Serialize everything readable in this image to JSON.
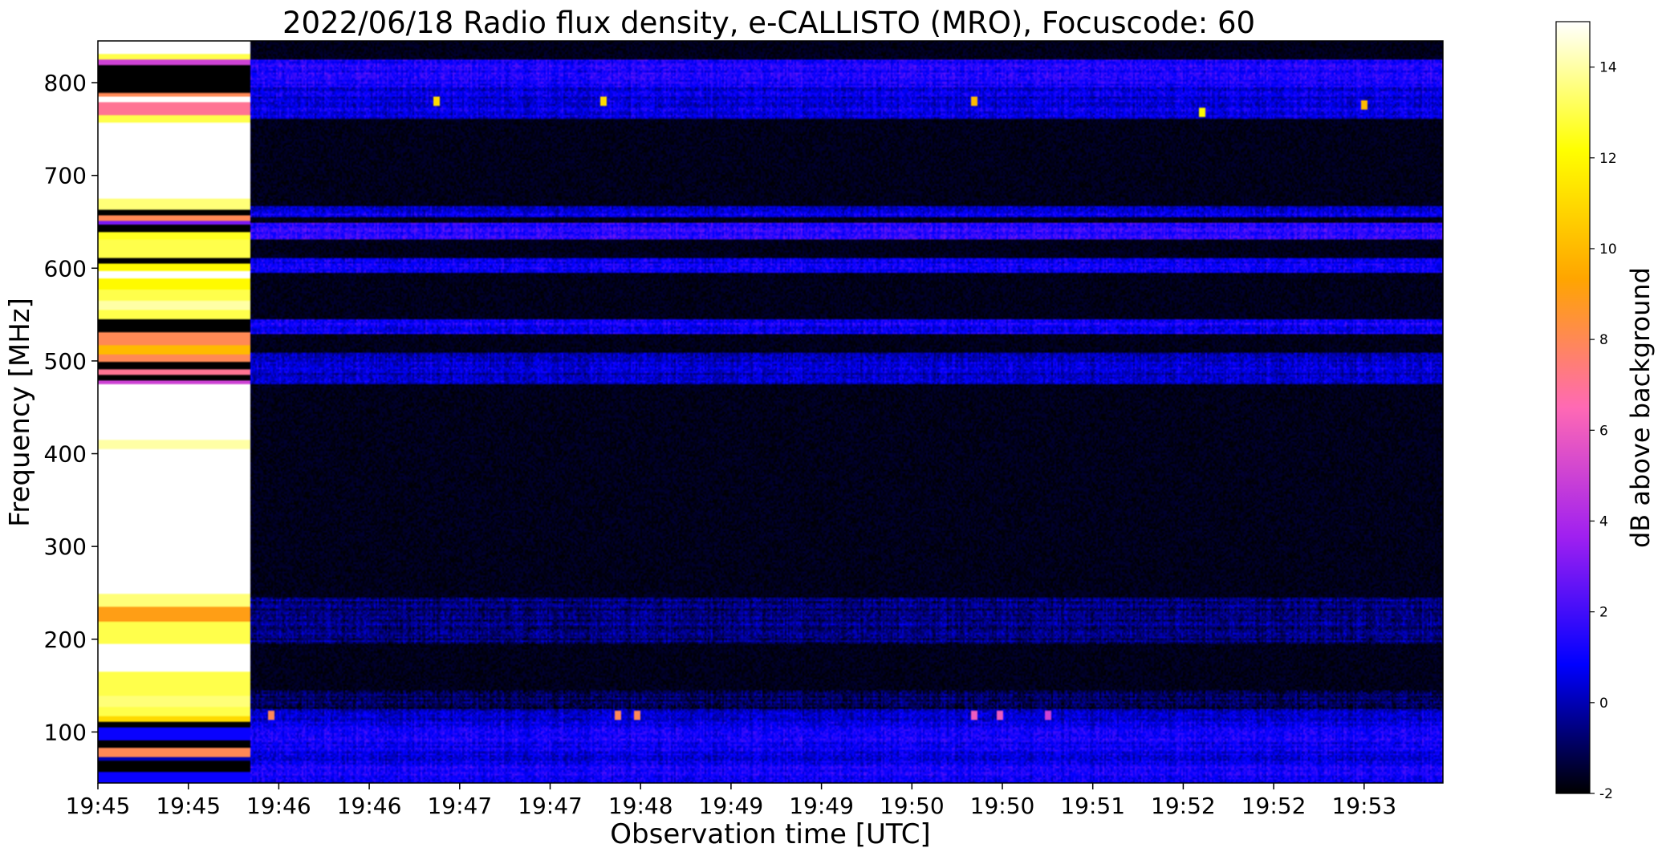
{
  "chart_data": {
    "type": "heatmap",
    "title": "2022/06/18  Radio flux density, e-CALLISTO (MRO), Focuscode: 60",
    "xlabel": "Observation time [UTC]",
    "ylabel": "Frequency [MHz]",
    "colorbar_label": "dB above background",
    "x_tick_labels": [
      "19:45",
      "19:45",
      "19:46",
      "19:46",
      "19:47",
      "19:47",
      "19:48",
      "19:49",
      "19:49",
      "19:50",
      "19:50",
      "19:51",
      "19:52",
      "19:52",
      "19:53"
    ],
    "y_ticks": [
      100,
      200,
      300,
      400,
      500,
      600,
      700,
      800
    ],
    "ylim": [
      45,
      845
    ],
    "colorbar_ticks": [
      -2,
      0,
      2,
      4,
      6,
      8,
      10,
      12,
      14
    ],
    "clim": [
      -2,
      15
    ],
    "colormap": [
      "#000000",
      "#0000ff",
      "#a020f0",
      "#ff69b4",
      "#ffa500",
      "#ffff00",
      "#ffffff"
    ],
    "calibration_segment": {
      "time_fraction_end": 0.113,
      "bands": [
        {
          "freq_min": 45,
          "freq_max": 58,
          "db": 1.0
        },
        {
          "freq_min": 58,
          "freq_max": 70,
          "db": -2.0
        },
        {
          "freq_min": 70,
          "freq_max": 74,
          "db": 0.0
        },
        {
          "freq_min": 74,
          "freq_max": 83,
          "db": 8.0
        },
        {
          "freq_min": 83,
          "freq_max": 92,
          "db": -2.0
        },
        {
          "freq_min": 92,
          "freq_max": 106,
          "db": 1.0
        },
        {
          "freq_min": 106,
          "freq_max": 112,
          "db": -2.0
        },
        {
          "freq_min": 112,
          "freq_max": 118,
          "db": 11.0
        },
        {
          "freq_min": 118,
          "freq_max": 128,
          "db": 13.0
        },
        {
          "freq_min": 128,
          "freq_max": 140,
          "db": 13.5
        },
        {
          "freq_min": 140,
          "freq_max": 165,
          "db": 13.0
        },
        {
          "freq_min": 165,
          "freq_max": 195,
          "db": 15.0
        },
        {
          "freq_min": 195,
          "freq_max": 220,
          "db": 13.0
        },
        {
          "freq_min": 220,
          "freq_max": 235,
          "db": 9.0
        },
        {
          "freq_min": 235,
          "freq_max": 250,
          "db": 13.5
        },
        {
          "freq_min": 250,
          "freq_max": 405,
          "db": 15.0
        },
        {
          "freq_min": 405,
          "freq_max": 415,
          "db": 14.0
        },
        {
          "freq_min": 415,
          "freq_max": 475,
          "db": 15.0
        },
        {
          "freq_min": 475,
          "freq_max": 480,
          "db": 5.0
        },
        {
          "freq_min": 480,
          "freq_max": 485,
          "db": -2.0
        },
        {
          "freq_min": 485,
          "freq_max": 492,
          "db": 7.0
        },
        {
          "freq_min": 492,
          "freq_max": 500,
          "db": -2.0
        },
        {
          "freq_min": 500,
          "freq_max": 508,
          "db": 8.0
        },
        {
          "freq_min": 508,
          "freq_max": 518,
          "db": 10.0
        },
        {
          "freq_min": 518,
          "freq_max": 532,
          "db": 8.0
        },
        {
          "freq_min": 532,
          "freq_max": 545,
          "db": -2.0
        },
        {
          "freq_min": 545,
          "freq_max": 555,
          "db": 13.0
        },
        {
          "freq_min": 555,
          "freq_max": 565,
          "db": 14.0
        },
        {
          "freq_min": 565,
          "freq_max": 578,
          "db": 13.0
        },
        {
          "freq_min": 578,
          "freq_max": 590,
          "db": 12.0
        },
        {
          "freq_min": 590,
          "freq_max": 598,
          "db": 15.0
        },
        {
          "freq_min": 598,
          "freq_max": 605,
          "db": 12.0
        },
        {
          "freq_min": 605,
          "freq_max": 612,
          "db": -2.0
        },
        {
          "freq_min": 612,
          "freq_max": 632,
          "db": 13.0
        },
        {
          "freq_min": 632,
          "freq_max": 640,
          "db": 12.5
        },
        {
          "freq_min": 640,
          "freq_max": 648,
          "db": -2.0
        },
        {
          "freq_min": 648,
          "freq_max": 652,
          "db": 3.0
        },
        {
          "freq_min": 652,
          "freq_max": 658,
          "db": 8.0
        },
        {
          "freq_min": 658,
          "freq_max": 664,
          "db": -2.0
        },
        {
          "freq_min": 664,
          "freq_max": 675,
          "db": 13.5
        },
        {
          "freq_min": 675,
          "freq_max": 758,
          "db": 15.0
        },
        {
          "freq_min": 758,
          "freq_max": 765,
          "db": 13.0
        },
        {
          "freq_min": 765,
          "freq_max": 780,
          "db": 7.0
        },
        {
          "freq_min": 780,
          "freq_max": 785,
          "db": 15.0
        },
        {
          "freq_min": 785,
          "freq_max": 790,
          "db": 8.0
        },
        {
          "freq_min": 790,
          "freq_max": 820,
          "db": -2.0
        },
        {
          "freq_min": 820,
          "freq_max": 825,
          "db": 5.0
        },
        {
          "freq_min": 825,
          "freq_max": 831,
          "db": 13.0
        },
        {
          "freq_min": 831,
          "freq_max": 845,
          "db": 15.0
        }
      ]
    },
    "observation_bands": [
      {
        "freq_min": 45,
        "freq_max": 70,
        "db": 1.0
      },
      {
        "freq_min": 70,
        "freq_max": 80,
        "db": 0.5
      },
      {
        "freq_min": 80,
        "freq_max": 92,
        "db": 1.0
      },
      {
        "freq_min": 92,
        "freq_max": 112,
        "db": 1.0
      },
      {
        "freq_min": 112,
        "freq_max": 125,
        "db": 0.0
      },
      {
        "freq_min": 125,
        "freq_max": 145,
        "db": -1.0
      },
      {
        "freq_min": 195,
        "freq_max": 245,
        "db": -0.7
      },
      {
        "freq_min": 475,
        "freq_max": 510,
        "db": 0.3
      },
      {
        "freq_min": 530,
        "freq_max": 545,
        "db": 1.0
      },
      {
        "freq_min": 595,
        "freq_max": 612,
        "db": 1.0
      },
      {
        "freq_min": 632,
        "freq_max": 650,
        "db": 1.5
      },
      {
        "freq_min": 655,
        "freq_max": 668,
        "db": 0.5
      },
      {
        "freq_min": 762,
        "freq_max": 795,
        "db": 0.5
      },
      {
        "freq_min": 795,
        "freq_max": 825,
        "db": 1.2
      }
    ],
    "bursts": [
      {
        "time_fraction": 0.128,
        "freq": 120,
        "db": 8
      },
      {
        "time_fraction": 0.385,
        "freq": 120,
        "db": 8
      },
      {
        "time_fraction": 0.4,
        "freq": 120,
        "db": 8
      },
      {
        "time_fraction": 0.65,
        "freq": 120,
        "db": 6
      },
      {
        "time_fraction": 0.67,
        "freq": 120,
        "db": 6
      },
      {
        "time_fraction": 0.705,
        "freq": 120,
        "db": 5
      },
      {
        "time_fraction": 0.25,
        "freq": 782,
        "db": 11
      },
      {
        "time_fraction": 0.375,
        "freq": 782,
        "db": 11
      },
      {
        "time_fraction": 0.65,
        "freq": 782,
        "db": 10
      },
      {
        "time_fraction": 0.82,
        "freq": 770,
        "db": 12
      },
      {
        "time_fraction": 0.94,
        "freq": 778,
        "db": 10
      }
    ]
  }
}
